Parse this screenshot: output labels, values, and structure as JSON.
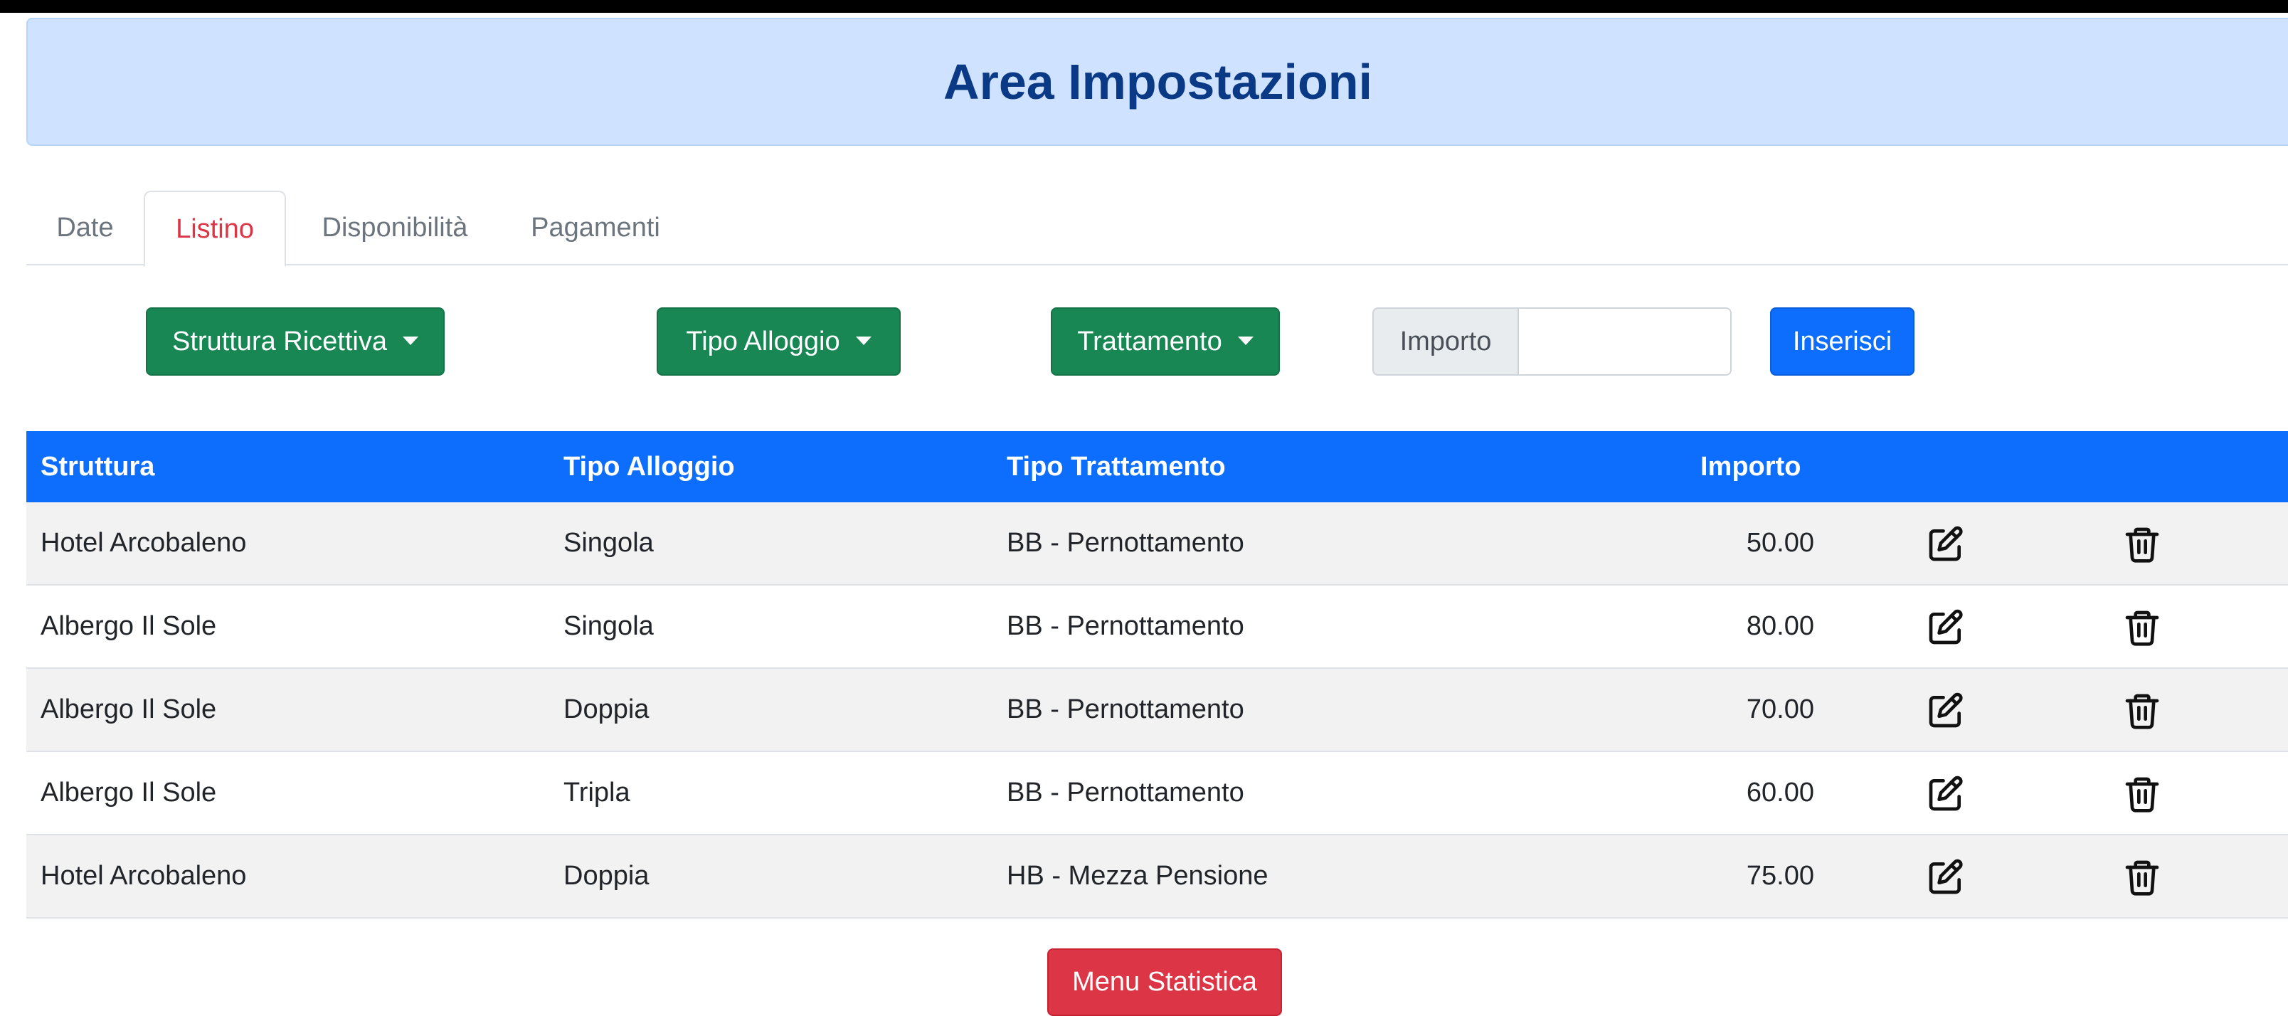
{
  "header": {
    "title": "Area Impostazioni"
  },
  "tabs": [
    {
      "label": "Date",
      "active": false
    },
    {
      "label": "Listino",
      "active": true
    },
    {
      "label": "Disponibilità",
      "active": false
    },
    {
      "label": "Pagamenti",
      "active": false
    }
  ],
  "filters": {
    "struttura_label": "Struttura Ricettiva",
    "alloggio_label": "Tipo Alloggio",
    "trattamento_label": "Trattamento",
    "importo_label": "Importo",
    "importo_value": "",
    "insert_label": "Inserisci"
  },
  "table": {
    "headers": [
      "Struttura",
      "Tipo Alloggio",
      "Tipo Trattamento",
      "Importo"
    ],
    "rows": [
      {
        "struttura": "Hotel Arcobaleno",
        "alloggio": "Singola",
        "trattamento": "BB - Pernottamento",
        "importo": "50.00"
      },
      {
        "struttura": "Albergo Il Sole",
        "alloggio": "Singola",
        "trattamento": "BB - Pernottamento",
        "importo": "80.00"
      },
      {
        "struttura": "Albergo Il Sole",
        "alloggio": "Doppia",
        "trattamento": "BB - Pernottamento",
        "importo": "70.00"
      },
      {
        "struttura": "Albergo Il Sole",
        "alloggio": "Tripla",
        "trattamento": "BB - Pernottamento",
        "importo": "60.00"
      },
      {
        "struttura": "Hotel Arcobaleno",
        "alloggio": "Doppia",
        "trattamento": "HB - Mezza Pensione",
        "importo": "75.00"
      }
    ],
    "row_actions": [
      "edit-icon",
      "trash-icon"
    ]
  },
  "footer": {
    "stats_label": "Menu Statistica"
  },
  "colors": {
    "header_bg": "#cfe2ff",
    "header_text": "#0a3a86",
    "active_tab": "#dc3545",
    "dropdown_button": "#198754",
    "primary": "#0d6efd",
    "danger": "#dc3545",
    "striped_row": "#f2f2f2"
  }
}
